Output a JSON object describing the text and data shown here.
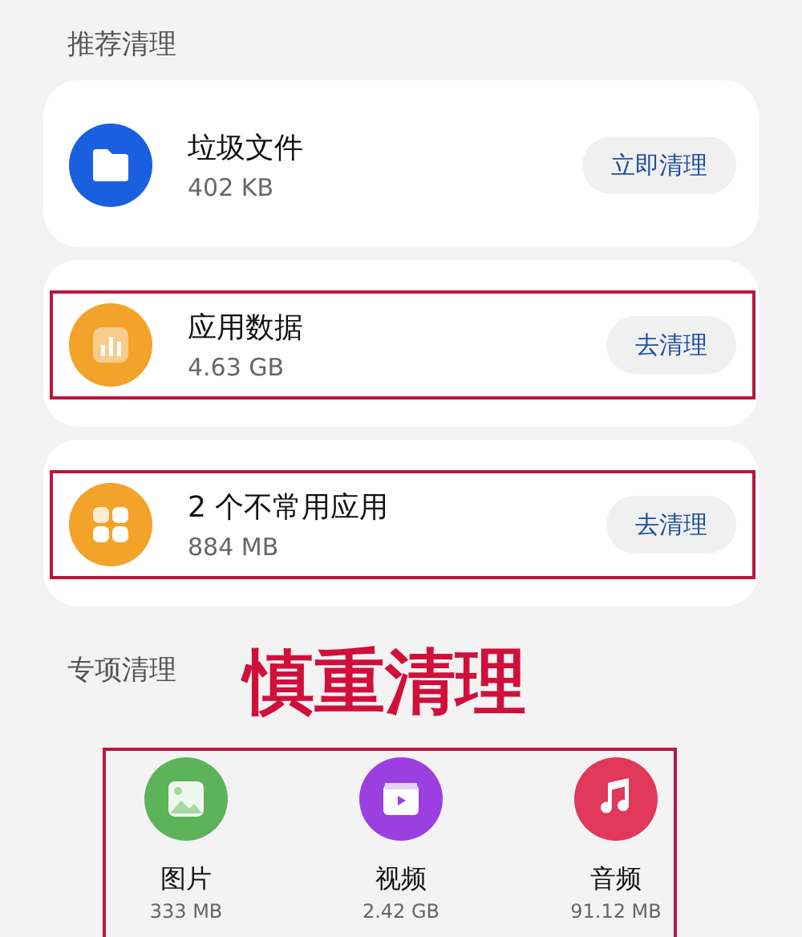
{
  "recommended": {
    "title": "推荐清理",
    "items": [
      {
        "kind": "files",
        "name": "垃圾文件",
        "size": "402 KB",
        "button": "立即清理",
        "highlighted": false
      },
      {
        "kind": "data",
        "name": "应用数据",
        "size": "4.63 GB",
        "button": "去清理",
        "highlighted": true
      },
      {
        "kind": "apps",
        "name": "2 个不常用应用",
        "size": "884 MB",
        "button": "去清理",
        "highlighted": true
      }
    ]
  },
  "annotation": "慎重清理",
  "special": {
    "title": "专项清理",
    "highlighted": true,
    "items": [
      {
        "kind": "images",
        "name": "图片",
        "size": "333 MB",
        "color": "#5cb35a"
      },
      {
        "kind": "video",
        "name": "视频",
        "size": "2.42 GB",
        "color": "#9b3fe0"
      },
      {
        "kind": "audio",
        "name": "音频",
        "size": "91.12 MB",
        "color": "#e2385a"
      }
    ]
  }
}
